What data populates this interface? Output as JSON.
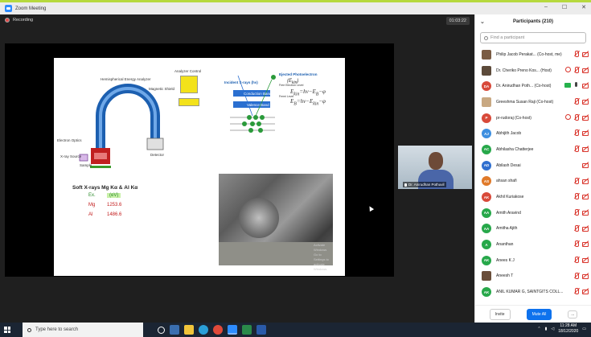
{
  "window": {
    "title": "Zoom Meeting",
    "minimize": "–",
    "maximize": "☐",
    "close": "✕"
  },
  "meeting": {
    "recording_label": "Recording",
    "timer": "01:03:22",
    "presenter_name": "Dr. Anirudhan Pothuvil"
  },
  "slide": {
    "analyzer_title": "Hemispherical Energy Analyzer",
    "magnetic_shield": "Magnetic Shield",
    "analyzer_control": "Analyzer Control",
    "electron_optics": "Electron Optics",
    "xray_source": "X-ray Source",
    "sample": "Sample",
    "detector": "Detector",
    "incident_xrays": "Incident X-rays (hν)",
    "ejected_photoelectron": "Ejected Photoelectron",
    "kinetic_energy": "(E",
    "kinetic_energy_sub": "kin",
    "conduction_band": "Conduction Band",
    "valence_band": "Valence Band",
    "free_electron_level": "Free Electron Level",
    "fermi_level": "Fermi Level",
    "equation1": "E",
    "eq1_sub": "kin",
    "eq1_rest": "=hν−E",
    "eq1_sub2": "B",
    "eq1_tail": "−φ",
    "equation2": "E",
    "eq2_sub": "B",
    "eq2_rest": "=hν−E",
    "eq2_sub2": "kin",
    "eq2_tail": "−φ",
    "soft_xrays_title": "Soft X-rays Mg Kα & Al Kα",
    "table_header_left": "Ex.",
    "table_header_right": "(eV)",
    "rows": [
      {
        "element": "Mg",
        "energy": "1253.6"
      },
      {
        "element": "Al",
        "energy": "1486.6"
      }
    ],
    "photo_watermark_1": "Activate Windows",
    "photo_watermark_2": "Go to Settings to activate Windows."
  },
  "participants": {
    "header": "Participants (210)",
    "search_placeholder": "Find a participant",
    "list": [
      {
        "name": "Philip Jacob Perakat... (Co-host, me)",
        "initials": "",
        "color": "#7a5c44",
        "photo": true,
        "icons": [
          "mic-off",
          "cam-off"
        ]
      },
      {
        "name": "Dr. Cheriko Preno Kos... (Host)",
        "initials": "",
        "color": "#5c4a3a",
        "photo": true,
        "icons": [
          "info",
          "mic-off",
          "cam-off"
        ]
      },
      {
        "name": "Dr. Anirudhan Poth... (Co-host)",
        "initials": "DA",
        "color": "#d84a3a",
        "photo": false,
        "icons": [
          "green",
          "mic-on",
          "cam-off"
        ]
      },
      {
        "name": "Greeshma Susan Raji (Co-host)",
        "initials": "",
        "color": "#c8a882",
        "photo": true,
        "icons": [
          "mic-off",
          "cam-off"
        ]
      },
      {
        "name": "pr-rudoraj (Co-host)",
        "initials": "P",
        "color": "#d84a3a",
        "photo": false,
        "icons": [
          "info",
          "mic-off",
          "cam-off"
        ]
      },
      {
        "name": "Abhijith Jacob",
        "initials": "AJ",
        "color": "#3d8fe0",
        "photo": false,
        "icons": [
          "mic-off",
          "cam-off"
        ]
      },
      {
        "name": "Abhilasha Chatterjee",
        "initials": "AC",
        "color": "#27a84a",
        "photo": false,
        "icons": [
          "mic-off",
          "cam-off"
        ]
      },
      {
        "name": "Abilash Desai",
        "initials": "AD",
        "color": "#2f6fcf",
        "photo": false,
        "icons": [
          "cam-off"
        ]
      },
      {
        "name": "ahsan shafi",
        "initials": "AS",
        "color": "#e07a2a",
        "photo": false,
        "icons": [
          "mic-off",
          "cam-off"
        ]
      },
      {
        "name": "Akhil Kuriakose",
        "initials": "AK",
        "color": "#d84a3a",
        "photo": false,
        "icons": [
          "mic-off",
          "cam-off"
        ]
      },
      {
        "name": "Amith Aravind",
        "initials": "AA",
        "color": "#27a84a",
        "photo": false,
        "icons": [
          "mic-off",
          "cam-off"
        ]
      },
      {
        "name": "Amitha Ajith",
        "initials": "AA",
        "color": "#27a84a",
        "photo": false,
        "icons": [
          "mic-off",
          "cam-off"
        ]
      },
      {
        "name": "Ananthan",
        "initials": "A",
        "color": "#27a84a",
        "photo": false,
        "icons": [
          "mic-off",
          "cam-off"
        ]
      },
      {
        "name": "Anees K J",
        "initials": "AK",
        "color": "#27a84a",
        "photo": false,
        "icons": [
          "mic-off",
          "cam-off"
        ]
      },
      {
        "name": "Aneesh T",
        "initials": "",
        "color": "#6a4e3a",
        "photo": true,
        "icons": [
          "mic-off",
          "cam-off"
        ]
      },
      {
        "name": "ANIL KUMAR G, SAINTGITS COLL...",
        "initials": "AK",
        "color": "#27a84a",
        "photo": false,
        "icons": [
          "mic-off",
          "cam-off"
        ]
      }
    ],
    "invite_label": "Invite",
    "mute_all_label": "Mute All",
    "more_label": "..."
  },
  "taskbar": {
    "search_placeholder": "Type here to search",
    "time": "11:28 AM",
    "date": "18/12/2020"
  }
}
